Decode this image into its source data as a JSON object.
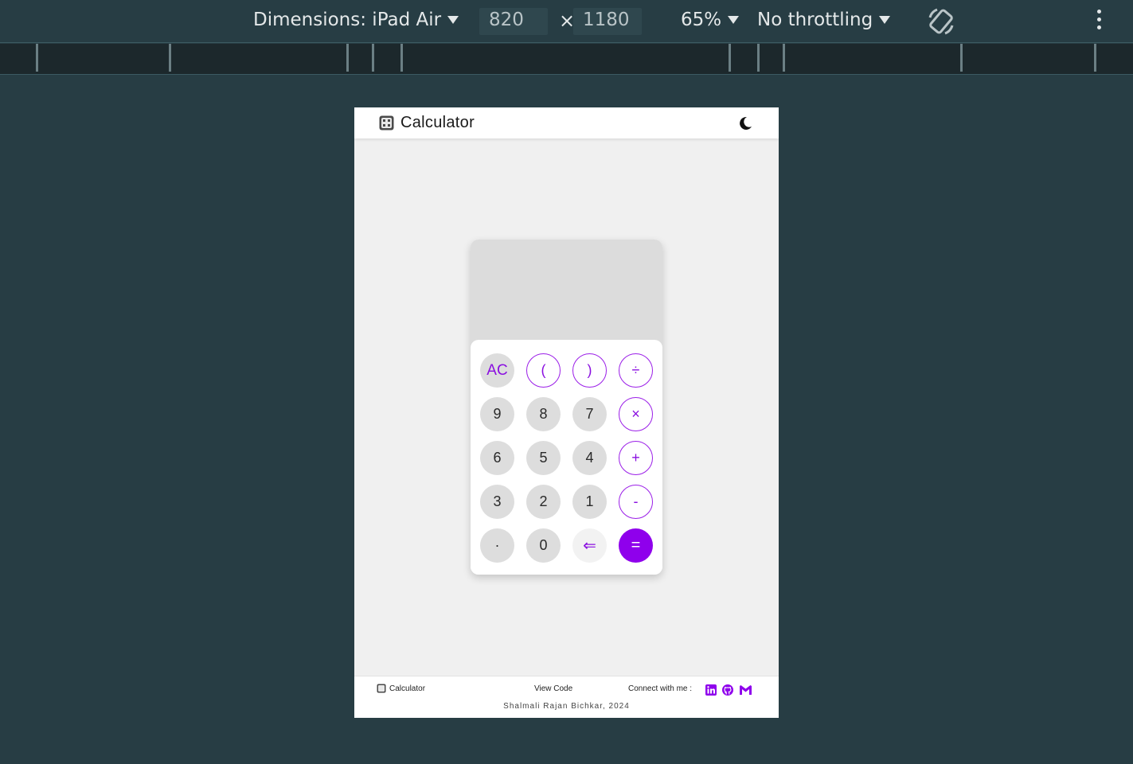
{
  "devtools": {
    "dimensions_label": "Dimensions: iPad Air",
    "width_value": "820",
    "times_symbol": "×",
    "height_value": "1180",
    "zoom": "65%",
    "throttling": "No throttling",
    "icons": [
      "caret-down-icon",
      "rotate-icon",
      "more-options-icon"
    ]
  },
  "header": {
    "title": "Calculator",
    "icons": [
      "calculator-icon",
      "moon-icon"
    ]
  },
  "calculator": {
    "display_value": "",
    "keys": {
      "ac": "AC",
      "lparen": "(",
      "rparen": ")",
      "divide": "÷",
      "k9": "9",
      "k8": "8",
      "k7": "7",
      "multiply": "×",
      "k6": "6",
      "k5": "5",
      "k4": "4",
      "plus": "+",
      "k3": "3",
      "k2": "2",
      "k1": "1",
      "minus": "-",
      "dot": "·",
      "k0": "0",
      "backspace": "⇐",
      "equals": "="
    }
  },
  "footer": {
    "brand": "Calculator",
    "view_code": "View Code",
    "connect": "Connect with me :",
    "credit": "Shalmali Rajan Bichkar, 2024",
    "icons": [
      "linkedin-icon",
      "github-icon",
      "gmail-icon"
    ]
  },
  "colors": {
    "accent": "#8f00ec",
    "devtools_bg": "#273d44",
    "page_bg": "#f0f0f0",
    "display_bg": "#dcdcdc",
    "key_bg": "#dddddd"
  }
}
